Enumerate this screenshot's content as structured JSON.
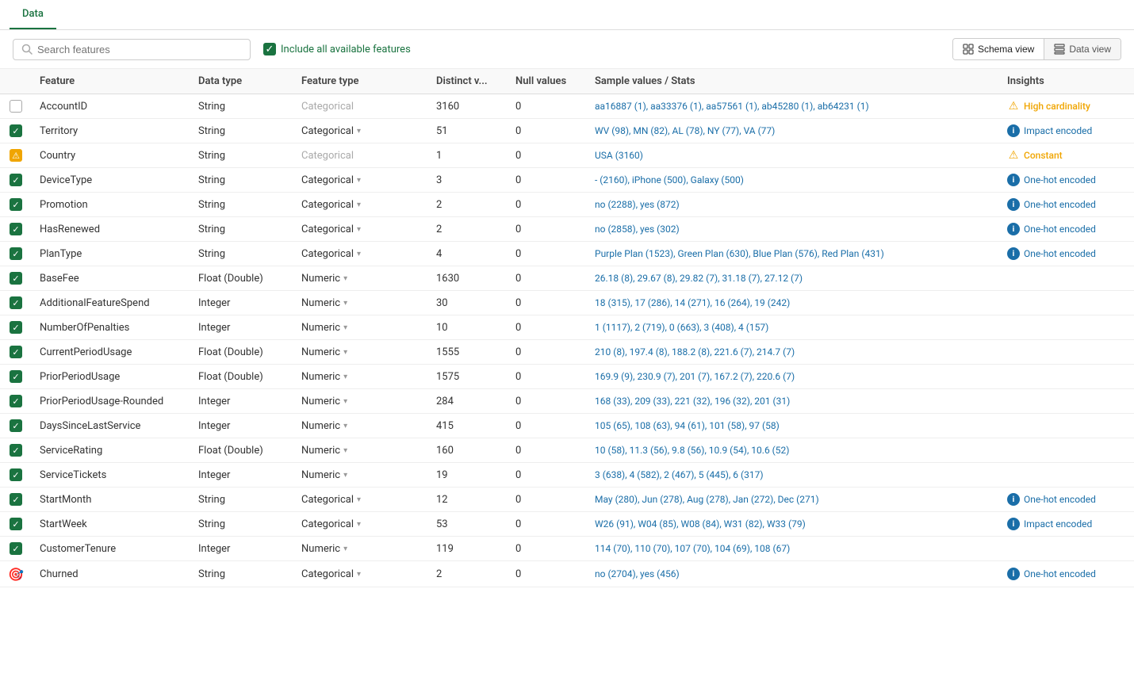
{
  "tabs": [
    {
      "label": "Data",
      "active": true
    }
  ],
  "toolbar": {
    "search_placeholder": "Search features",
    "include_label": "Include all available features",
    "schema_view_label": "Schema view",
    "data_view_label": "Data view",
    "active_view": "schema"
  },
  "table": {
    "columns": [
      "",
      "Feature",
      "Data type",
      "Feature type",
      "Distinct v...",
      "Null values",
      "Sample values / Stats",
      "Insights"
    ],
    "rows": [
      {
        "check": "unchecked",
        "feature": "AccountID",
        "datatype": "String",
        "featuretype": "Categorical",
        "featuretype_grayed": true,
        "featuretype_dropdown": false,
        "distinct": "3160",
        "null": "0",
        "sample": "aa16887 (1), aa33376 (1), aa57561 (1), ab45280 (1), ab64231 (1)",
        "insight_type": "warning",
        "insight_text": "High cardinality"
      },
      {
        "check": "checked",
        "feature": "Territory",
        "datatype": "String",
        "featuretype": "Categorical",
        "featuretype_grayed": false,
        "featuretype_dropdown": true,
        "distinct": "51",
        "null": "0",
        "sample": "WV (98), MN (82), AL (78), NY (77), VA (77)",
        "insight_type": "info",
        "insight_text": "Impact encoded"
      },
      {
        "check": "warning",
        "feature": "Country",
        "datatype": "String",
        "featuretype": "Categorical",
        "featuretype_grayed": true,
        "featuretype_dropdown": false,
        "distinct": "1",
        "null": "0",
        "sample": "USA (3160)",
        "insight_type": "warning",
        "insight_text": "Constant"
      },
      {
        "check": "checked",
        "feature": "DeviceType",
        "datatype": "String",
        "featuretype": "Categorical",
        "featuretype_grayed": false,
        "featuretype_dropdown": true,
        "distinct": "3",
        "null": "0",
        "sample": "- (2160), iPhone (500), Galaxy (500)",
        "insight_type": "info",
        "insight_text": "One-hot encoded"
      },
      {
        "check": "checked",
        "feature": "Promotion",
        "datatype": "String",
        "featuretype": "Categorical",
        "featuretype_grayed": false,
        "featuretype_dropdown": true,
        "distinct": "2",
        "null": "0",
        "sample": "no (2288), yes (872)",
        "insight_type": "info",
        "insight_text": "One-hot encoded"
      },
      {
        "check": "checked",
        "feature": "HasRenewed",
        "datatype": "String",
        "featuretype": "Categorical",
        "featuretype_grayed": false,
        "featuretype_dropdown": true,
        "distinct": "2",
        "null": "0",
        "sample": "no (2858), yes (302)",
        "insight_type": "info",
        "insight_text": "One-hot encoded"
      },
      {
        "check": "checked",
        "feature": "PlanType",
        "datatype": "String",
        "featuretype": "Categorical",
        "featuretype_grayed": false,
        "featuretype_dropdown": true,
        "distinct": "4",
        "null": "0",
        "sample": "Purple Plan (1523), Green Plan (630), Blue Plan (576), Red Plan (431)",
        "insight_type": "info",
        "insight_text": "One-hot encoded"
      },
      {
        "check": "checked",
        "feature": "BaseFee",
        "datatype": "Float (Double)",
        "featuretype": "Numeric",
        "featuretype_grayed": false,
        "featuretype_dropdown": true,
        "distinct": "1630",
        "null": "0",
        "sample": "26.18 (8), 29.67 (8), 29.82 (7), 31.18 (7), 27.12 (7)",
        "insight_type": "none",
        "insight_text": ""
      },
      {
        "check": "checked",
        "feature": "AdditionalFeatureSpend",
        "datatype": "Integer",
        "featuretype": "Numeric",
        "featuretype_grayed": false,
        "featuretype_dropdown": true,
        "distinct": "30",
        "null": "0",
        "sample": "18 (315), 17 (286), 14 (271), 16 (264), 19 (242)",
        "insight_type": "none",
        "insight_text": ""
      },
      {
        "check": "checked",
        "feature": "NumberOfPenalties",
        "datatype": "Integer",
        "featuretype": "Numeric",
        "featuretype_grayed": false,
        "featuretype_dropdown": true,
        "distinct": "10",
        "null": "0",
        "sample": "1 (1117), 2 (719), 0 (663), 3 (408), 4 (157)",
        "insight_type": "none",
        "insight_text": ""
      },
      {
        "check": "checked",
        "feature": "CurrentPeriodUsage",
        "datatype": "Float (Double)",
        "featuretype": "Numeric",
        "featuretype_grayed": false,
        "featuretype_dropdown": true,
        "distinct": "1555",
        "null": "0",
        "sample": "210 (8), 197.4 (8), 188.2 (8), 221.6 (7), 214.7 (7)",
        "insight_type": "none",
        "insight_text": ""
      },
      {
        "check": "checked",
        "feature": "PriorPeriodUsage",
        "datatype": "Float (Double)",
        "featuretype": "Numeric",
        "featuretype_grayed": false,
        "featuretype_dropdown": true,
        "distinct": "1575",
        "null": "0",
        "sample": "169.9 (9), 230.9 (7), 201 (7), 167.2 (7), 220.6 (7)",
        "insight_type": "none",
        "insight_text": ""
      },
      {
        "check": "checked",
        "feature": "PriorPeriodUsage-Rounded",
        "datatype": "Integer",
        "featuretype": "Numeric",
        "featuretype_grayed": false,
        "featuretype_dropdown": true,
        "distinct": "284",
        "null": "0",
        "sample": "168 (33), 209 (33), 221 (32), 196 (32), 201 (31)",
        "insight_type": "none",
        "insight_text": ""
      },
      {
        "check": "checked",
        "feature": "DaysSinceLastService",
        "datatype": "Integer",
        "featuretype": "Numeric",
        "featuretype_grayed": false,
        "featuretype_dropdown": true,
        "distinct": "415",
        "null": "0",
        "sample": "105 (65), 108 (63), 94 (61), 101 (58), 97 (58)",
        "insight_type": "none",
        "insight_text": ""
      },
      {
        "check": "checked",
        "feature": "ServiceRating",
        "datatype": "Float (Double)",
        "featuretype": "Numeric",
        "featuretype_grayed": false,
        "featuretype_dropdown": true,
        "distinct": "160",
        "null": "0",
        "sample": "10 (58), 11.3 (56), 9.8 (56), 10.9 (54), 10.6 (52)",
        "insight_type": "none",
        "insight_text": ""
      },
      {
        "check": "checked",
        "feature": "ServiceTickets",
        "datatype": "Integer",
        "featuretype": "Numeric",
        "featuretype_grayed": false,
        "featuretype_dropdown": true,
        "distinct": "19",
        "null": "0",
        "sample": "3 (638), 4 (582), 2 (467), 5 (445), 6 (317)",
        "insight_type": "none",
        "insight_text": ""
      },
      {
        "check": "checked",
        "feature": "StartMonth",
        "datatype": "String",
        "featuretype": "Categorical",
        "featuretype_grayed": false,
        "featuretype_dropdown": true,
        "distinct": "12",
        "null": "0",
        "sample": "May (280), Jun (278), Aug (278), Jan (272), Dec (271)",
        "insight_type": "info",
        "insight_text": "One-hot encoded"
      },
      {
        "check": "checked",
        "feature": "StartWeek",
        "datatype": "String",
        "featuretype": "Categorical",
        "featuretype_grayed": false,
        "featuretype_dropdown": true,
        "distinct": "53",
        "null": "0",
        "sample": "W26 (91), W04 (85), W08 (84), W31 (82), W33 (79)",
        "insight_type": "info",
        "insight_text": "Impact encoded"
      },
      {
        "check": "checked",
        "feature": "CustomerTenure",
        "datatype": "Integer",
        "featuretype": "Numeric",
        "featuretype_grayed": false,
        "featuretype_dropdown": true,
        "distinct": "119",
        "null": "0",
        "sample": "114 (70), 110 (70), 107 (70), 104 (69), 108 (67)",
        "insight_type": "none",
        "insight_text": ""
      },
      {
        "check": "target",
        "feature": "Churned",
        "datatype": "String",
        "featuretype": "Categorical",
        "featuretype_grayed": false,
        "featuretype_dropdown": true,
        "distinct": "2",
        "null": "0",
        "sample": "no (2704), yes (456)",
        "insight_type": "info",
        "insight_text": "One-hot encoded"
      }
    ]
  }
}
